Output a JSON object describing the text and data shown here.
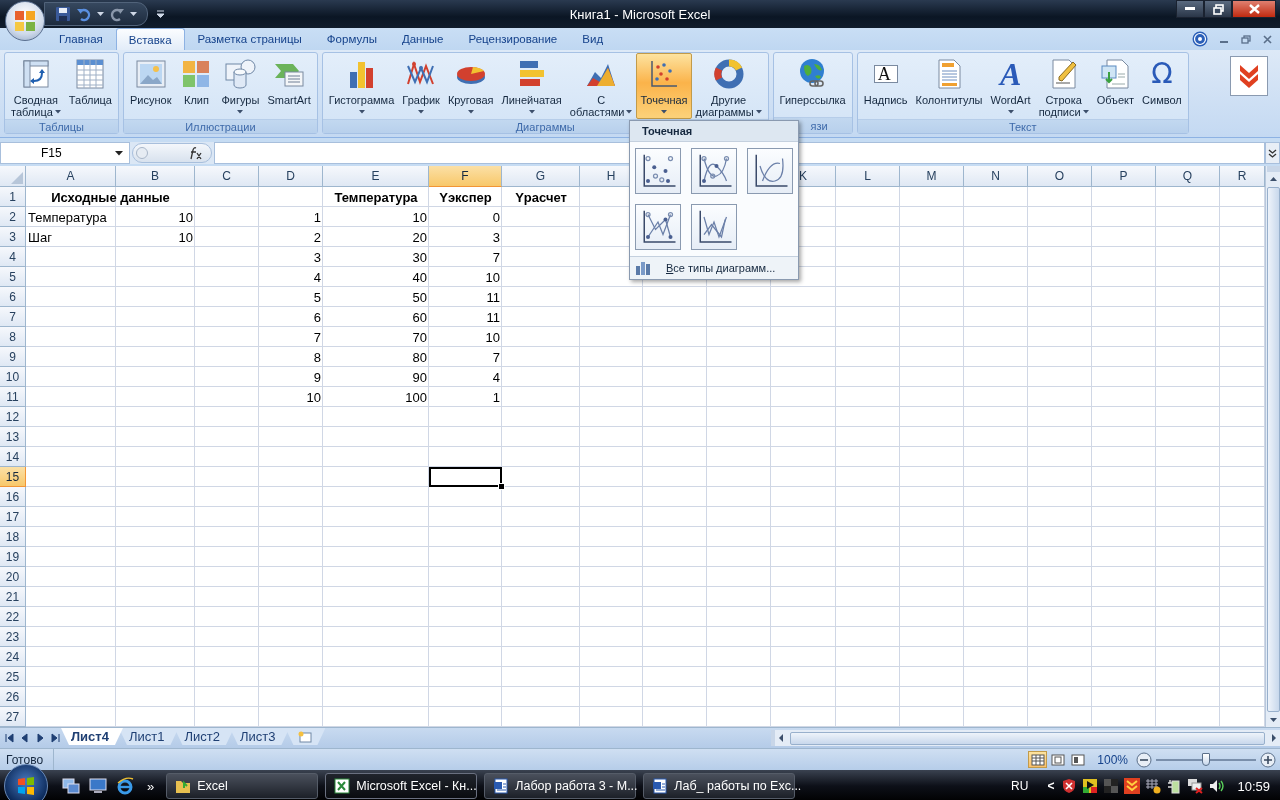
{
  "window": {
    "title": "Книга1 - Microsoft Excel"
  },
  "ribbon_tabs": [
    {
      "label": "Главная",
      "selected": false
    },
    {
      "label": "Вставка",
      "selected": true
    },
    {
      "label": "Разметка страницы",
      "selected": false
    },
    {
      "label": "Формулы",
      "selected": false
    },
    {
      "label": "Данные",
      "selected": false
    },
    {
      "label": "Рецензирование",
      "selected": false
    },
    {
      "label": "Вид",
      "selected": false
    }
  ],
  "ribbon_groups": [
    {
      "title": "Таблицы",
      "title_clipped": false,
      "buttons": [
        {
          "lines": [
            "Сводная",
            "таблица"
          ],
          "dropdown": true,
          "pressed": false
        },
        {
          "lines": [
            "Таблица"
          ],
          "dropdown": false,
          "pressed": false
        }
      ]
    },
    {
      "title": "Иллюстрации",
      "title_clipped": false,
      "buttons": [
        {
          "lines": [
            "Рисунок"
          ],
          "dropdown": false,
          "pressed": false
        },
        {
          "lines": [
            "Клип"
          ],
          "dropdown": false,
          "pressed": false
        },
        {
          "lines": [
            "Фигуры"
          ],
          "dropdown": true,
          "pressed": false
        },
        {
          "lines": [
            "SmartArt"
          ],
          "dropdown": false,
          "pressed": false
        }
      ]
    },
    {
      "title": "Диаграммы",
      "title_clipped": false,
      "buttons": [
        {
          "lines": [
            "Гистограмма"
          ],
          "dropdown": true,
          "pressed": false
        },
        {
          "lines": [
            "График"
          ],
          "dropdown": true,
          "pressed": false
        },
        {
          "lines": [
            "Круговая"
          ],
          "dropdown": true,
          "pressed": false
        },
        {
          "lines": [
            "Линейчатая"
          ],
          "dropdown": true,
          "pressed": false
        },
        {
          "lines": [
            "С",
            "областями"
          ],
          "dropdown": true,
          "pressed": false
        },
        {
          "lines": [
            "Точечная"
          ],
          "dropdown": true,
          "pressed": true
        },
        {
          "lines": [
            "Другие",
            "диаграммы"
          ],
          "dropdown": true,
          "pressed": false
        }
      ]
    },
    {
      "title": "язи",
      "title_clipped": true,
      "buttons": [
        {
          "lines": [
            "Гиперссылка"
          ],
          "dropdown": false,
          "pressed": false
        }
      ]
    },
    {
      "title": "Текст",
      "title_clipped": false,
      "buttons": [
        {
          "lines": [
            "Надпись"
          ],
          "glyph": "A",
          "dropdown": false,
          "pressed": false
        },
        {
          "lines": [
            "Колонтитулы"
          ],
          "dropdown": false,
          "pressed": false
        },
        {
          "lines": [
            "WordArt"
          ],
          "glyph": "A",
          "dropdown": true,
          "pressed": false
        },
        {
          "lines": [
            "Строка",
            "подписи"
          ],
          "dropdown": true,
          "pressed": false
        },
        {
          "lines": [
            "Объект"
          ],
          "dropdown": false,
          "pressed": false
        },
        {
          "lines": [
            "Символ"
          ],
          "glyph": "Ω",
          "dropdown": false,
          "pressed": false
        }
      ]
    }
  ],
  "name_box": "F15",
  "chart_menu": {
    "title": "Точечная",
    "options": [
      {
        "selected": false
      },
      {
        "selected": false
      },
      {
        "selected": false
      },
      {
        "selected": false
      },
      {
        "selected": false
      }
    ],
    "footer": "Все типы диаграмм..."
  },
  "columns": [
    {
      "label": "A",
      "selected": false
    },
    {
      "label": "B",
      "selected": false
    },
    {
      "label": "C",
      "selected": false
    },
    {
      "label": "D",
      "selected": false
    },
    {
      "label": "E",
      "selected": false
    },
    {
      "label": "F",
      "selected": true
    },
    {
      "label": "G",
      "selected": false
    },
    {
      "label": "H",
      "selected": false
    },
    null,
    null,
    {
      "label": "K",
      "selected": false
    },
    {
      "label": "L",
      "selected": false
    },
    {
      "label": "M",
      "selected": false
    },
    {
      "label": "N",
      "selected": false
    },
    {
      "label": "O",
      "selected": false
    },
    {
      "label": "P",
      "selected": false
    },
    {
      "label": "Q",
      "selected": false
    },
    {
      "label": "R",
      "selected": false
    }
  ],
  "rows": [
    {
      "header": "1",
      "selected": false,
      "cells": [
        {
          "text": "Исходные данные",
          "kind": "heading",
          "merged": true
        },
        null,
        null,
        null,
        {
          "text": "Температура",
          "kind": "heading"
        },
        {
          "text": "Yэкспер",
          "kind": "heading"
        },
        {
          "text": "Yрасчет",
          "kind": "heading"
        }
      ]
    },
    {
      "header": "2",
      "selected": false,
      "cells": [
        {
          "text": "Температура",
          "kind": "label"
        },
        {
          "text": "10",
          "kind": "number"
        },
        null,
        {
          "text": "1",
          "kind": "number"
        },
        {
          "text": "10",
          "kind": "number"
        },
        {
          "text": "0",
          "kind": "number"
        }
      ]
    },
    {
      "header": "3",
      "selected": false,
      "cells": [
        {
          "text": "Шаг",
          "kind": "label"
        },
        {
          "text": "10",
          "kind": "number"
        },
        null,
        {
          "text": "2",
          "kind": "number"
        },
        {
          "text": "20",
          "kind": "number"
        },
        {
          "text": "3",
          "kind": "number"
        }
      ]
    },
    {
      "header": "4",
      "selected": false,
      "cells": [
        null,
        null,
        null,
        {
          "text": "3",
          "kind": "number"
        },
        {
          "text": "30",
          "kind": "number"
        },
        {
          "text": "7",
          "kind": "number"
        }
      ]
    },
    {
      "header": "5",
      "selected": false,
      "cells": [
        null,
        null,
        null,
        {
          "text": "4",
          "kind": "number"
        },
        {
          "text": "40",
          "kind": "number"
        },
        {
          "text": "10",
          "kind": "number"
        }
      ]
    },
    {
      "header": "6",
      "selected": false,
      "cells": [
        null,
        null,
        null,
        {
          "text": "5",
          "kind": "number"
        },
        {
          "text": "50",
          "kind": "number"
        },
        {
          "text": "11",
          "kind": "number"
        }
      ]
    },
    {
      "header": "7",
      "selected": false,
      "cells": [
        null,
        null,
        null,
        {
          "text": "6",
          "kind": "number"
        },
        {
          "text": "60",
          "kind": "number"
        },
        {
          "text": "11",
          "kind": "number"
        }
      ]
    },
    {
      "header": "8",
      "selected": false,
      "cells": [
        null,
        null,
        null,
        {
          "text": "7",
          "kind": "number"
        },
        {
          "text": "70",
          "kind": "number"
        },
        {
          "text": "10",
          "kind": "number"
        }
      ]
    },
    {
      "header": "9",
      "selected": false,
      "cells": [
        null,
        null,
        null,
        {
          "text": "8",
          "kind": "number"
        },
        {
          "text": "80",
          "kind": "number"
        },
        {
          "text": "7",
          "kind": "number"
        }
      ]
    },
    {
      "header": "10",
      "selected": false,
      "cells": [
        null,
        null,
        null,
        {
          "text": "9",
          "kind": "number"
        },
        {
          "text": "90",
          "kind": "number"
        },
        {
          "text": "4",
          "kind": "number"
        }
      ]
    },
    {
      "header": "11",
      "selected": false,
      "cells": [
        null,
        null,
        null,
        {
          "text": "10",
          "kind": "number"
        },
        {
          "text": "100",
          "kind": "number"
        },
        {
          "text": "1",
          "kind": "number"
        }
      ]
    },
    {
      "header": "12",
      "selected": false
    },
    {
      "header": "13",
      "selected": false
    },
    {
      "header": "14",
      "selected": false
    },
    {
      "header": "15",
      "selected": true,
      "cells": [
        null,
        null,
        null,
        null,
        null,
        {
          "active": true
        }
      ]
    },
    {
      "header": "16",
      "selected": false
    },
    {
      "header": "17",
      "selected": false
    },
    {
      "header": "18",
      "selected": false
    },
    {
      "header": "19",
      "selected": false
    },
    {
      "header": "20",
      "selected": false
    },
    {
      "header": "21",
      "selected": false
    },
    {
      "header": "22",
      "selected": false
    },
    {
      "header": "23",
      "selected": false
    },
    {
      "header": "24",
      "selected": false
    },
    {
      "header": "25",
      "selected": false
    },
    {
      "header": "26",
      "selected": false
    },
    {
      "header": "27",
      "selected": false
    }
  ],
  "sheet_tabs": [
    {
      "label": "Лист4",
      "selected": true
    },
    {
      "label": "Лист1",
      "selected": false
    },
    {
      "label": "Лист2",
      "selected": false
    },
    {
      "label": "Лист3",
      "selected": false
    }
  ],
  "status_bar": {
    "text": "Готово",
    "views": [
      {
        "selected": true
      },
      {
        "selected": false
      },
      {
        "selected": false
      }
    ],
    "zoom": "100%",
    "zoom_slider": {
      "level": 0.5
    }
  },
  "taskbar": {
    "overflow": "»",
    "tasks": [
      {
        "label": "Excel",
        "selected": false
      },
      {
        "label": "Microsoft Excel - Кн...",
        "selected": true
      },
      {
        "label": "Лабор работа 3 - М...",
        "selected": false
      },
      {
        "label": "Лаб_ работы по Exc...",
        "selected": false
      }
    ],
    "language": "RU",
    "tray_toggle": "<",
    "clock": "10:59"
  }
}
